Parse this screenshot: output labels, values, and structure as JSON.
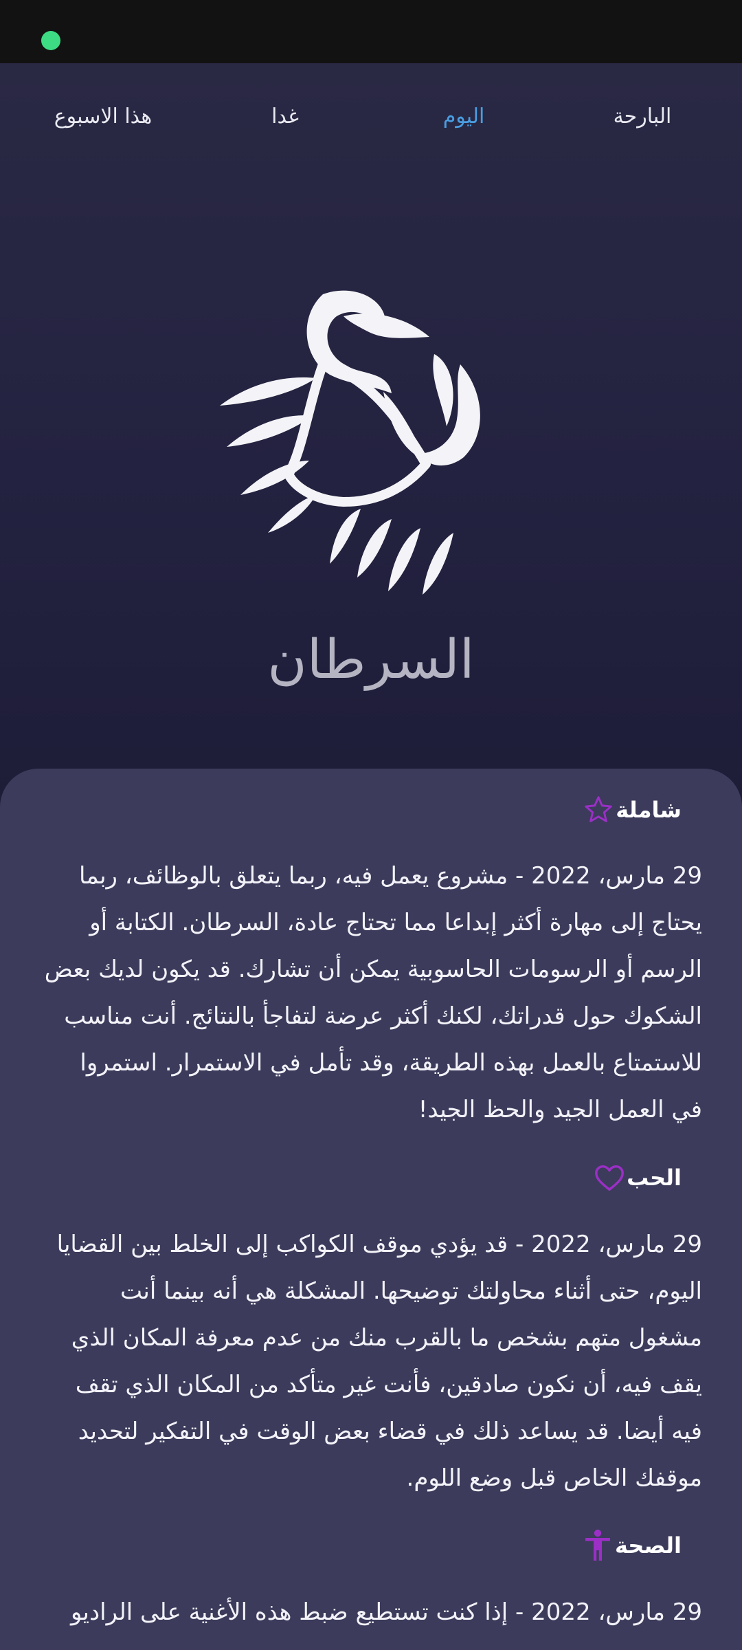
{
  "tabs": {
    "this_week": "هذا الاسبوع",
    "tomorrow": "غدا",
    "today": "اليوم",
    "yesterday": "البارحة",
    "active": "today"
  },
  "sign": {
    "name": "السرطان",
    "icon": "cancer-crab-icon"
  },
  "colors": {
    "active_tab": "#4a9ee2",
    "section_icon": "#9b2fc6",
    "status_dot": "#3ddc84"
  },
  "sections": [
    {
      "title": "شاملة",
      "icon": "star-icon",
      "text": "29 مارس، 2022 - مشروع يعمل فيه، ربما يتعلق بالوظائف، ربما يحتاج إلى مهارة أكثر إبداعا مما تحتاج عادة، السرطان. الكتابة أو الرسم أو الرسومات الحاسوبية يمكن أن تشارك. قد يكون لديك بعض الشكوك حول قدراتك، لكنك أكثر عرضة لتفاجأ بالنتائج. أنت مناسب للاستمتاع بالعمل بهذه الطريقة، وقد تأمل في الاستمرار. استمروا في العمل الجيد والحظ الجيد!"
    },
    {
      "title": "الحب",
      "icon": "heart-icon",
      "text": "29 مارس، 2022 - قد يؤدي موقف الكواكب إلى الخلط بين القضايا اليوم، حتى أثناء محاولتك توضيحها. المشكلة هي أنه بينما أنت مشغول متهم بشخص ما بالقرب منك من عدم معرفة المكان الذي يقف فيه، أن نكون صادقين، فأنت غير متأكد من المكان الذي تقف فيه أيضا. قد يساعد ذلك في قضاء بعض الوقت في التفكير لتحديد موقفك الخاص قبل وضع اللوم."
    },
    {
      "title": "الصحة",
      "icon": "person-health-icon",
      "text": "29 مارس، 2022 - إذا كنت تستطيع ضبط هذه الأغنية على الراديو"
    }
  ]
}
